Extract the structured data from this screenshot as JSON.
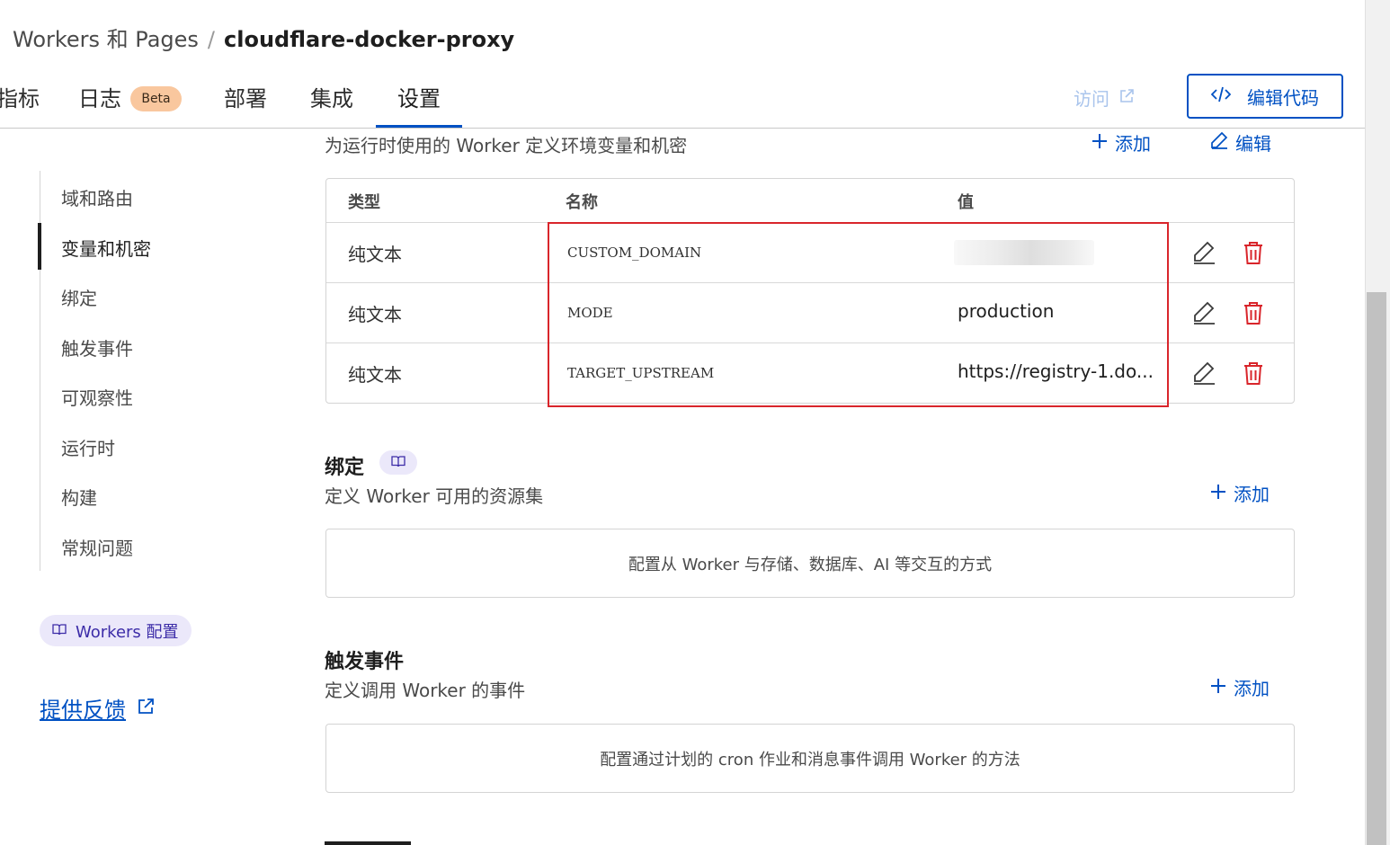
{
  "breadcrumb": {
    "parent": "Workers 和 Pages",
    "separator": "/",
    "current": "cloudflare-docker-proxy"
  },
  "tabs": [
    {
      "label": "指标"
    },
    {
      "label": "日志",
      "badge": "Beta"
    },
    {
      "label": "部署"
    },
    {
      "label": "集成"
    },
    {
      "label": "设置",
      "active": true
    }
  ],
  "header_actions": {
    "visit_label": "访问",
    "edit_code_label": "编辑代码"
  },
  "sidebar": {
    "items": [
      {
        "label": "域和路由"
      },
      {
        "label": "变量和机密",
        "active": true
      },
      {
        "label": "绑定"
      },
      {
        "label": "触发事件"
      },
      {
        "label": "可观察性"
      },
      {
        "label": "运行时"
      },
      {
        "label": "构建"
      },
      {
        "label": "常规问题"
      }
    ],
    "workers_config_label": "Workers 配置",
    "feedback_label": "提供反馈"
  },
  "variables_section": {
    "description": "为运行时使用的 Worker 定义环境变量和机密",
    "add_label": "添加",
    "edit_label": "编辑",
    "columns": {
      "type": "类型",
      "name": "名称",
      "value": "值"
    },
    "rows": [
      {
        "type": "纯文本",
        "name": "CUSTOM_DOMAIN",
        "value": ""
      },
      {
        "type": "纯文本",
        "name": "MODE",
        "value": "production"
      },
      {
        "type": "纯文本",
        "name": "TARGET_UPSTREAM",
        "value": "https://registry-1.do..."
      }
    ]
  },
  "bindings_section": {
    "title": "绑定",
    "description": "定义 Worker 可用的资源集",
    "add_label": "添加",
    "empty_text": "配置从 Worker 与存储、数据库、AI 等交互的方式"
  },
  "triggers_section": {
    "title": "触发事件",
    "description": "定义调用 Worker 的事件",
    "add_label": "添加",
    "empty_text": "配置通过计划的 cron 作业和消息事件调用 Worker 的方法"
  },
  "colors": {
    "accent": "#0051c3",
    "danger": "#d9252b",
    "badge_beta": "#f9c79e",
    "config_badge": "#ebe8fa"
  }
}
